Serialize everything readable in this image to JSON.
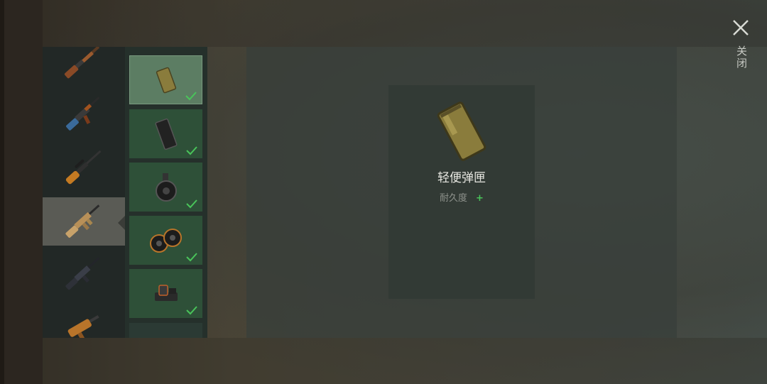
{
  "header": {
    "close_label": "关闭"
  },
  "weapons": [
    {
      "icon": "lever-rifle-icon",
      "selected": false
    },
    {
      "icon": "ak-rifle-icon",
      "selected": false
    },
    {
      "icon": "sniper-rifle-icon",
      "selected": false
    },
    {
      "icon": "scar-rifle-icon",
      "selected": true
    },
    {
      "icon": "m4-rifle-icon",
      "selected": false
    },
    {
      "icon": "smg-icon",
      "selected": false
    }
  ],
  "attachments": [
    {
      "icon": "light-magazine-icon",
      "equipped": true,
      "active": true
    },
    {
      "icon": "extended-magazine-icon",
      "equipped": true,
      "active": false
    },
    {
      "icon": "drum-magazine-icon",
      "equipped": true,
      "active": false
    },
    {
      "icon": "dual-drum-magazine-icon",
      "equipped": true,
      "active": false
    },
    {
      "icon": "holo-sight-icon",
      "equipped": true,
      "active": false
    },
    {
      "icon": "partial-slot-icon",
      "equipped": false,
      "active": false
    }
  ],
  "detail": {
    "icon": "light-magazine-icon",
    "name": "轻便弹匣",
    "stat_label": "耐久度",
    "stat_value": "+"
  },
  "colors": {
    "accent_green": "#49c45a",
    "slot_green": "#2e5038",
    "slot_active": "#5c7d63",
    "magazine_gold": "#8a7c3c"
  }
}
